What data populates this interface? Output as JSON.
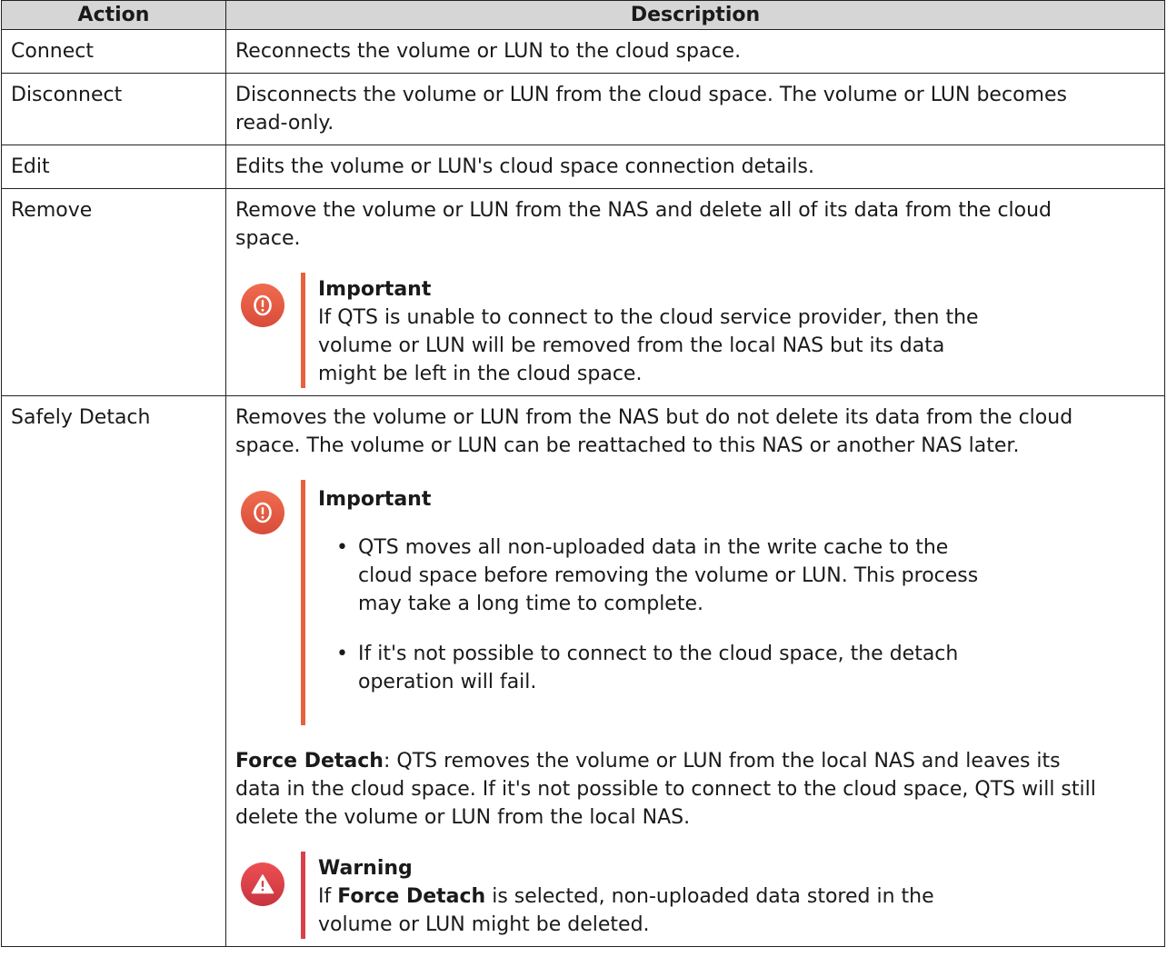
{
  "table": {
    "headers": {
      "action": "Action",
      "description": "Description"
    },
    "rows": {
      "connect": {
        "action": "Connect",
        "description": "Reconnects the volume or LUN to the cloud space."
      },
      "disconnect": {
        "action": "Disconnect",
        "description_line1": "Disconnects the volume or LUN from the cloud space. The volume or LUN becomes",
        "description_line2": "read-only."
      },
      "edit": {
        "action": "Edit",
        "description": "Edits the volume or LUN's cloud space connection details."
      },
      "remove": {
        "action": "Remove",
        "description_line1": "Remove the volume or LUN from the NAS and delete all of its data from the cloud",
        "description_line2": "space.",
        "note": {
          "title": "Important",
          "line1": "If QTS is unable to connect to the cloud service provider, then the",
          "line2": "volume or LUN will be removed from the local NAS but its data",
          "line3": "might be left in the cloud space."
        }
      },
      "safely_detach": {
        "action": "Safely Detach",
        "description_line1": "Removes the volume or LUN from the NAS but do not delete its data from the cloud",
        "description_line2": "space. The volume or LUN can be reattached to this NAS or another NAS later.",
        "note": {
          "title": "Important",
          "bullet_char": "•",
          "bullets": [
            {
              "line1": "QTS moves all non-uploaded data in the write cache to the",
              "line2": "cloud space before removing the volume or LUN. This process",
              "line3": "may take a long time to complete."
            },
            {
              "line1": "If it's not possible to connect to the cloud space, the detach",
              "line2": "operation will fail."
            }
          ]
        },
        "force_detach": {
          "label": "Force Detach",
          "text1": ": QTS removes the volume or LUN from the local NAS and leaves its",
          "text2": "data in the cloud space. If it's not possible to connect to the cloud space, QTS will still",
          "text3": "delete the volume or LUN from the local NAS."
        },
        "warning": {
          "title": "Warning",
          "prefix": "If ",
          "bold": "Force Detach",
          "suffix": " is selected, non-uploaded data stored in the",
          "line2": "volume or LUN might be deleted."
        }
      }
    }
  },
  "icons": {
    "important": "important-exclamation-circle-icon",
    "warning": "warning-triangle-icon"
  },
  "colors": {
    "header_bg": "#d6d6d6",
    "important_accent": "#e8613f",
    "warning_accent": "#d9404a"
  }
}
